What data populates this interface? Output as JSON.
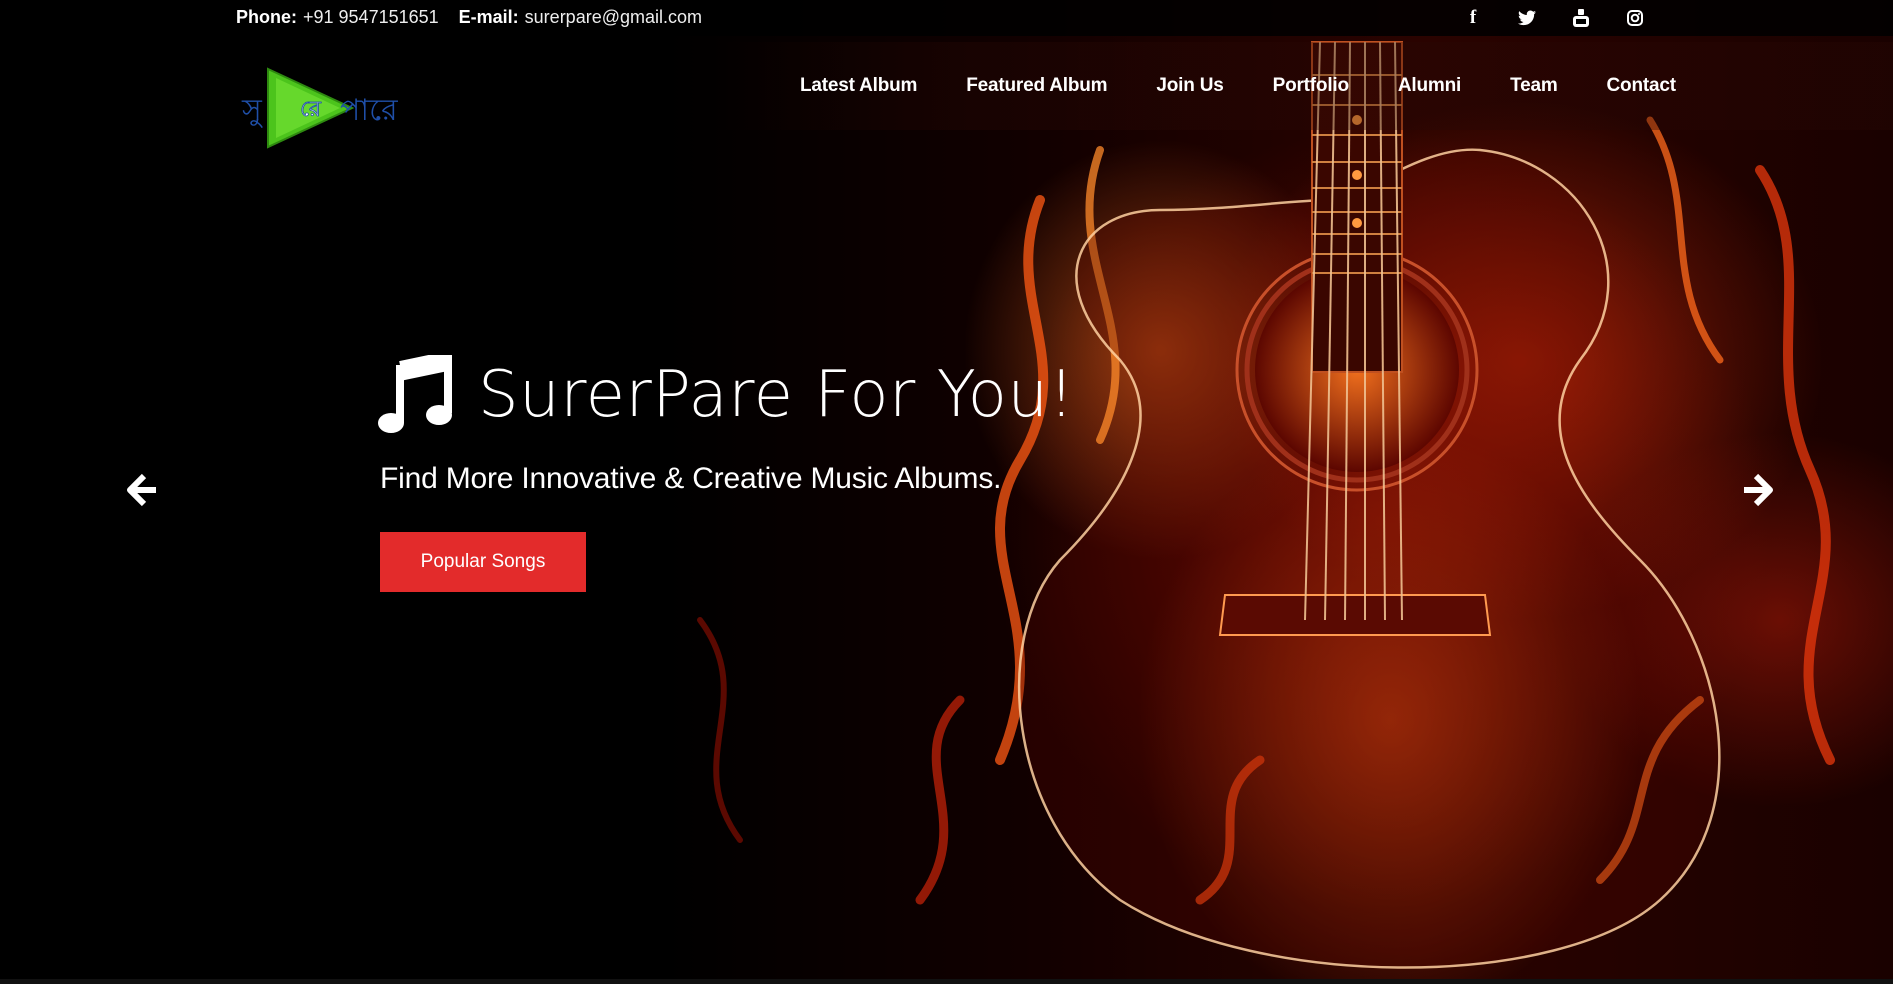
{
  "topbar": {
    "phone_label": "Phone:",
    "phone_value": "+91 9547151651",
    "email_label": "E-mail:",
    "email_value": "surerpare@gmail.com",
    "social_icons": [
      "facebook-icon",
      "twitter-icon",
      "youtube-icon",
      "instagram-icon"
    ]
  },
  "nav": {
    "items": [
      {
        "label": "Latest Album"
      },
      {
        "label": "Featured Album"
      },
      {
        "label": "Join Us"
      },
      {
        "label": "Portfolio"
      },
      {
        "label": "Alumni"
      },
      {
        "label": "Team"
      },
      {
        "label": "Contact"
      }
    ]
  },
  "hero": {
    "title": "SurerPare For You!",
    "subtitle": "Find More Innovative & Creative Music Albums.",
    "cta_label": "Popular Songs",
    "prev_icon": "arrow-left-icon",
    "next_icon": "arrow-right-icon"
  },
  "colors": {
    "cta": "#e32b2b",
    "logo_green": "#4cc41c",
    "logo_blue": "#1f4fa8"
  }
}
